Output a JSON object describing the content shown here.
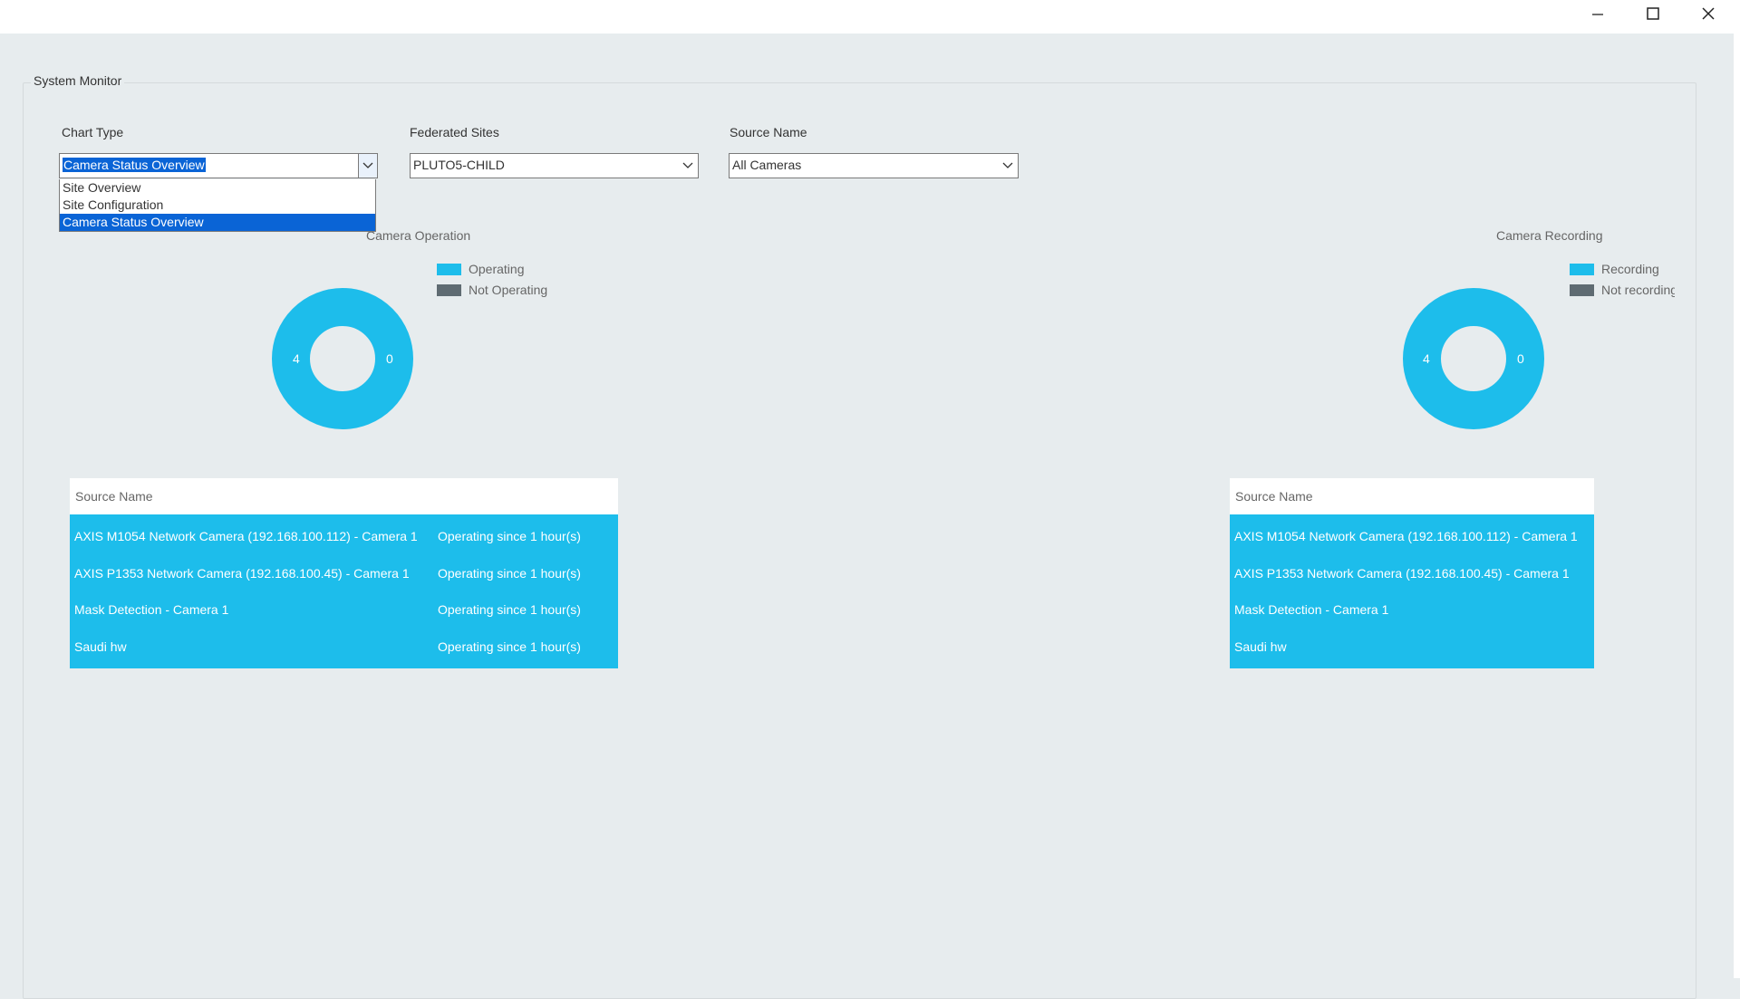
{
  "window": {
    "minimize_icon": "minimize-icon",
    "maximize_icon": "maximize-icon",
    "close_icon": "close-icon"
  },
  "group": {
    "title": "System Monitor"
  },
  "filters": {
    "chart_type": {
      "label": "Chart Type",
      "value": "Camera Status Overview",
      "options": [
        "Site Overview",
        "Site Configuration",
        "Camera Status Overview"
      ],
      "expanded": true
    },
    "federated_sites": {
      "label": "Federated Sites",
      "value": "PLUTO5-CHILD"
    },
    "source_name": {
      "label": "Source Name",
      "value": "All Cameras"
    }
  },
  "colors": {
    "accent": "#1dbdeb",
    "not_active": "#5f6b72",
    "selection": "#0a64d6",
    "background": "#e7ecee"
  },
  "camera_operation": {
    "title": "Camera Operation",
    "legend": [
      "Operating",
      "Not Operating"
    ],
    "operating_count": "4",
    "not_operating_count": "0",
    "table": {
      "header": "Source Name",
      "rows": [
        {
          "name": "AXIS M1054 Network Camera (192.168.100.112) - Camera 1",
          "status": "Operating since 1 hour(s)"
        },
        {
          "name": "AXIS P1353 Network Camera (192.168.100.45) - Camera 1",
          "status": "Operating since 1 hour(s)"
        },
        {
          "name": "Mask Detection - Camera 1",
          "status": "Operating since 1 hour(s)"
        },
        {
          "name": "Saudi hw",
          "status": "Operating since 1 hour(s)"
        }
      ]
    }
  },
  "camera_recording": {
    "title": "Camera Recording",
    "legend": [
      "Recording",
      "Not recording"
    ],
    "recording_count": "4",
    "not_recording_count": "0",
    "table": {
      "header": "Source Name",
      "rows": [
        {
          "name": "AXIS M1054 Network Camera (192.168.100.112) - Camera 1"
        },
        {
          "name": "AXIS P1353 Network Camera (192.168.100.45) - Camera 1"
        },
        {
          "name": "Mask Detection - Camera 1"
        },
        {
          "name": "Saudi hw"
        }
      ]
    }
  }
}
